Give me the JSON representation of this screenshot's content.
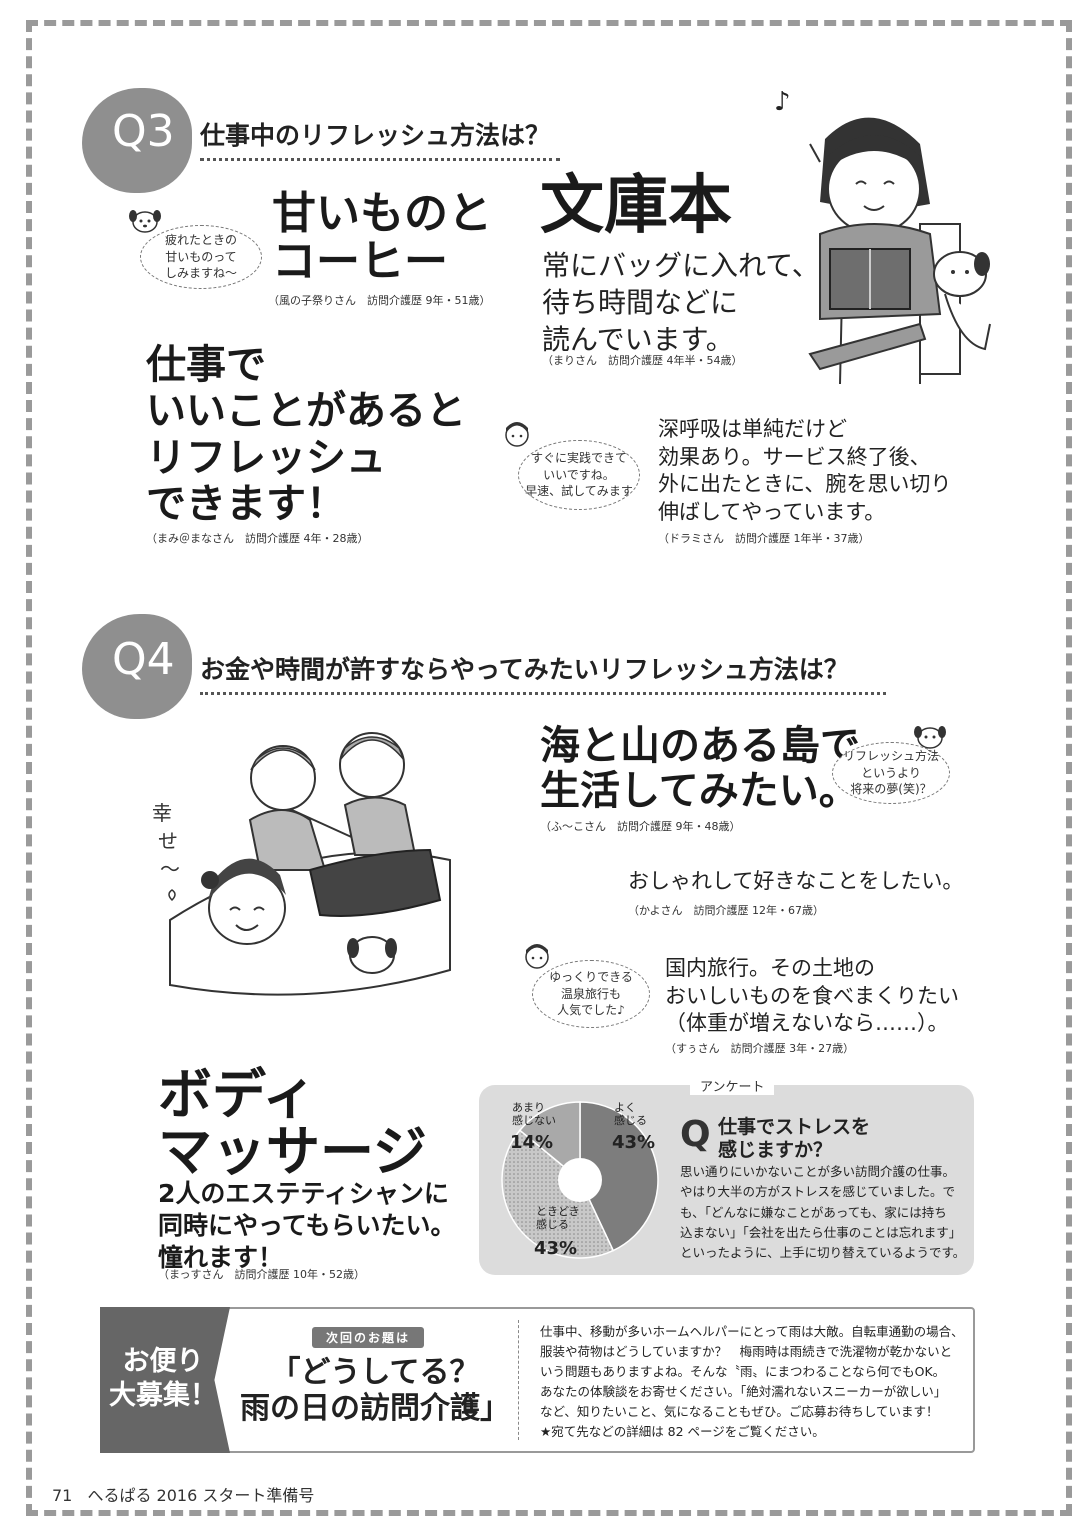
{
  "q3": {
    "num": "Q3",
    "title": "仕事中のリフレッシュ方法は？",
    "a1": {
      "headline": [
        "甘いものと",
        "コーヒー"
      ],
      "bubble": [
        "疲れたときの",
        "甘いものって",
        "しみますね～"
      ],
      "credit": "（風の子祭りさん　訪問介護歴 9年・51歳）"
    },
    "a2": {
      "headline": "文庫本",
      "body": [
        "常にバッグに入れて、",
        "待ち時間などに",
        "読んでいます。"
      ],
      "credit": "（まりさん　訪問介護歴 4年半・54歳）"
    },
    "a3": {
      "headline": [
        "仕事で",
        "いいことがあると",
        "リフレッシュ",
        "できます！"
      ],
      "credit": "（まみ＠まなさん　訪問介護歴 4年・28歳）"
    },
    "a4": {
      "body": [
        "深呼吸は単純だけど",
        "効果あり。サービス終了後、",
        "外に出たときに、腕を思い切り",
        "伸ばしてやっています。"
      ],
      "bubble": [
        "すぐに実践できて",
        "いいですね。",
        "早速、試してみます"
      ],
      "credit": "（ドラミさん　訪問介護歴 1年半・37歳）"
    }
  },
  "q4": {
    "num": "Q4",
    "title": "お金や時間が許すならやってみたいリフレッシュ方法は？",
    "a1": {
      "headline": [
        "海と山のある島で",
        "生活してみたい。"
      ],
      "bubble": [
        "リフレッシュ方法",
        "というより",
        "将来の夢(笑)？"
      ],
      "credit": "（ふ～こさん　訪問介護歴 9年・48歳）"
    },
    "a2": {
      "body": "おしゃれして好きなことをしたい。",
      "credit": "（かよさん　訪問介護歴 12年・67歳）"
    },
    "a3": {
      "body": [
        "国内旅行。その土地の",
        "おいしいものを食べまくりたい",
        "（体重が増えないなら……）。"
      ],
      "bubble": [
        "ゆっくりできる",
        "温泉旅行も",
        "人気でした♪"
      ],
      "credit": "（すぅさん　訪問介護歴 3年・27歳）"
    },
    "a4": {
      "headline": [
        "ボディ",
        "マッサージ"
      ],
      "body": [
        "2人のエステティシャンに",
        "同時にやってもらいたい。",
        "憧れます！"
      ],
      "credit": "（まっすさん　訪問介護歴 10年・52歳）"
    },
    "illus_text": [
      "幸",
      "せ",
      "～"
    ]
  },
  "survey": {
    "tag": "アンケート",
    "q_mark": "Q",
    "question": [
      "仕事でストレスを",
      "感じますか？"
    ],
    "body": [
      "思い通りにいかないことが多い訪問介護の仕事。",
      "やはり大半の方がストレスを感じていました。で",
      "も、「どんなに嫌なことがあっても、家には持ち",
      "込まない」「会社を出たら仕事のことは忘れます」",
      "といったように、上手に切り替えているようです。"
    ],
    "chart_data": {
      "type": "pie",
      "categories": [
        "よく感じる",
        "ときどき感じる",
        "あまり感じない"
      ],
      "values": [
        43,
        43,
        14
      ],
      "labels": [
        [
          "よく",
          "感じる"
        ],
        [
          "ときどき",
          "感じる"
        ],
        [
          "あまり",
          "感じない"
        ]
      ],
      "pct_labels": [
        "43%",
        "43%",
        "14%"
      ],
      "colors": [
        "#7d7d7d",
        "#c8c8c8",
        "#a9a9a9"
      ]
    }
  },
  "bottom": {
    "banner": [
      "お便り",
      "大募集！"
    ],
    "next_tag": "次回のお題は",
    "next_title": [
      "「どうしてる？",
      "雨の日の訪問介護」"
    ],
    "body": [
      "仕事中、移動が多いホームヘルパーにとって雨は大敵。自転車通勤の場合、",
      "服装や荷物はどうしていますか？　梅雨時は雨続きで洗濯物が乾かないと",
      "いう問題もありますよね。そんな〝雨〟にまつわることなら何でもOK。",
      "あなたの体験談をお寄せください。「絶対濡れないスニーカーが欲しい」",
      "など、知りたいこと、気になることもぜひ。ご応募お待ちしています！",
      "★宛て先などの詳細は 82 ページをご覧ください。"
    ]
  },
  "footer": {
    "page": "71",
    "mag": "へるぱる 2016 スタート準備号"
  }
}
